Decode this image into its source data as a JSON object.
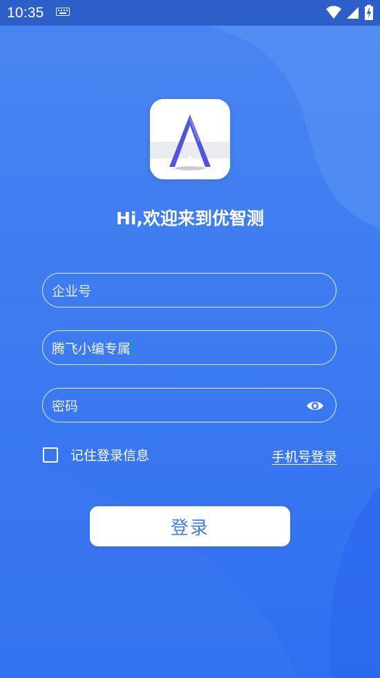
{
  "status_bar": {
    "time": "10:35",
    "icons": [
      "keyboard-icon",
      "wifi-icon",
      "signal-icon",
      "battery-icon"
    ]
  },
  "logo": {
    "letter": "A",
    "name": "app-logo"
  },
  "welcome": "Hi,欢迎来到优智测",
  "form": {
    "company_placeholder": "企业号",
    "username_value": "腾飞小编专属",
    "password_placeholder": "密码",
    "remember_label": "记住登录信息",
    "phone_login_label": "手机号登录",
    "login_button": "登录"
  },
  "colors": {
    "background": "#3f7ef0",
    "status_bar": "#2c5fc7",
    "button_text": "#3d7cf0",
    "caret": "#1aa09e"
  }
}
